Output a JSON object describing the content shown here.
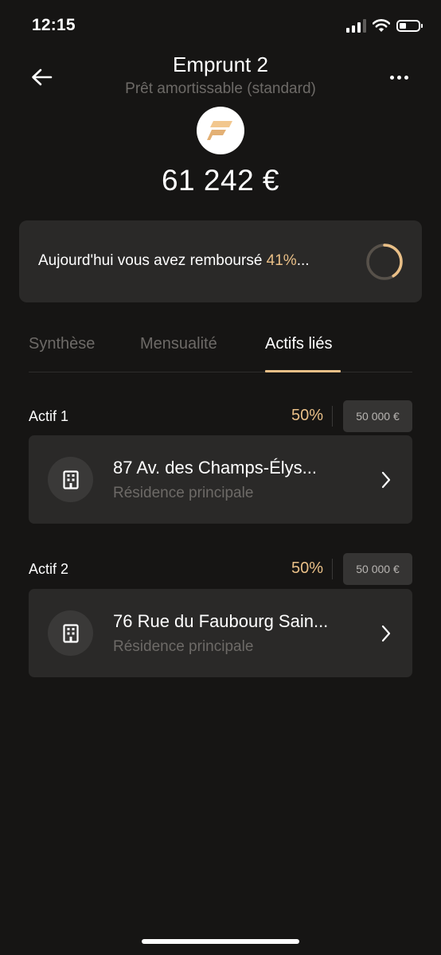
{
  "status_bar": {
    "time": "12:15",
    "icons": [
      "signal-icon",
      "wifi-icon",
      "battery-icon"
    ]
  },
  "header": {
    "title": "Emprunt 2",
    "subtitle": "Prêt amortissable (standard)",
    "amount": "61 242 €",
    "back_icon": "arrow-left-icon",
    "more_icon": "more-horizontal-icon",
    "logo_icon": "lender-logo-icon"
  },
  "progress": {
    "text_prefix": "Aujourd'hui vous avez remboursé ",
    "percent": "41%",
    "suffix": "...",
    "repaid_fraction": 0.41
  },
  "tabs": [
    {
      "label": "Synthèse",
      "active": false
    },
    {
      "label": "Mensualité",
      "active": false
    },
    {
      "label": "Actifs liés",
      "active": true
    }
  ],
  "assets": [
    {
      "label": "Actif 1",
      "share": "50%",
      "value": "50 000 €",
      "address": "87 Av. des Champs-Élys...",
      "type": "Résidence principale",
      "icon": "building-icon"
    },
    {
      "label": "Actif 2",
      "share": "50%",
      "value": "50 000 €",
      "address": "76 Rue du Faubourg Sain...",
      "type": "Résidence principale",
      "icon": "building-icon"
    }
  ],
  "colors": {
    "background": "#161514",
    "card": "#2a2928",
    "accent": "#e9bf87",
    "muted_text": "#6d6a67"
  }
}
